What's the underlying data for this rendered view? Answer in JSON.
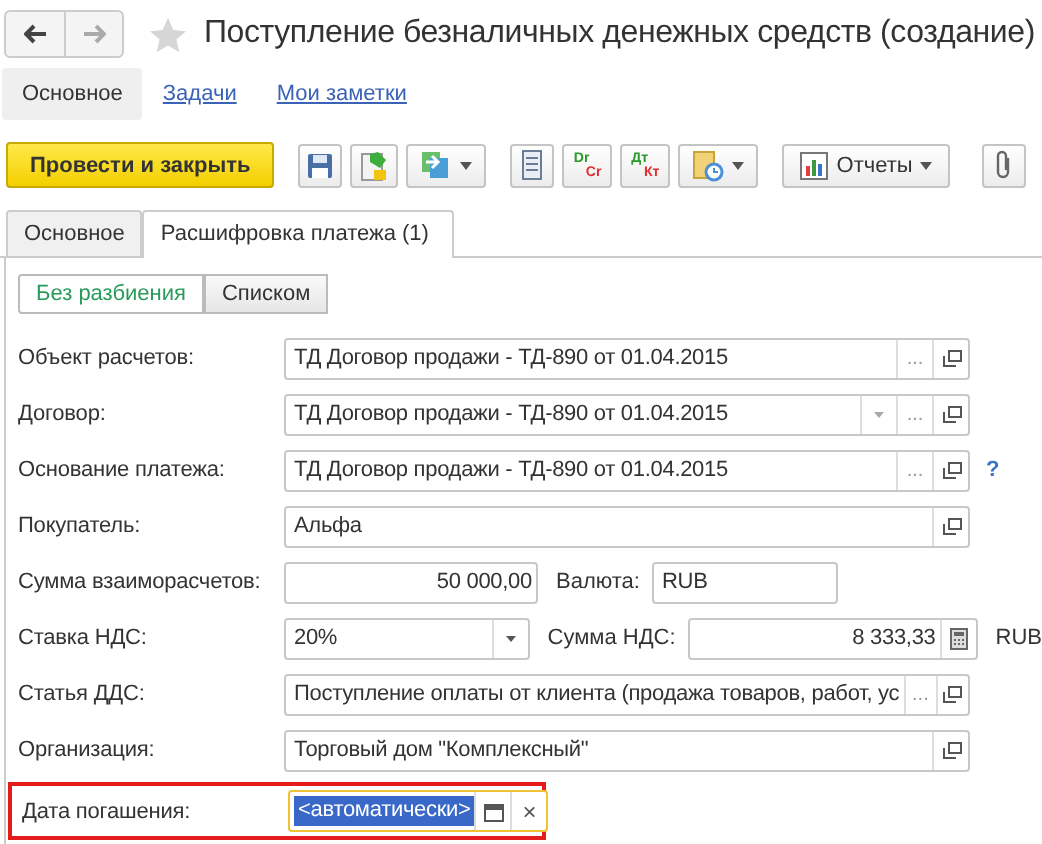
{
  "window": {
    "title": "Поступление безналичных денежных средств (создание)"
  },
  "nav": [
    {
      "label": "Основное",
      "selected": true
    },
    {
      "label": "Задачи",
      "selected": false
    },
    {
      "label": "Мои заметки",
      "selected": false
    }
  ],
  "toolbar": [
    {
      "kind": "primary",
      "label": "Провести и закрыть"
    },
    {
      "kind": "save"
    },
    {
      "kind": "post"
    },
    {
      "kind": "copy",
      "dropdown": true
    },
    {
      "kind": "list"
    },
    {
      "kind": "drcr",
      "top": "Dr",
      "bottom": "Cr"
    },
    {
      "kind": "drcr",
      "top": "Дт",
      "bottom": "Кт"
    },
    {
      "kind": "docs",
      "dropdown": true
    },
    {
      "kind": "reports",
      "label": "Отчеты",
      "dropdown": true
    },
    {
      "kind": "attach"
    }
  ],
  "tabs": [
    {
      "label": "Основное",
      "selected": false
    },
    {
      "label": "Расшифровка платежа (1)",
      "selected": true
    }
  ],
  "modes": [
    {
      "label": "Без разбиения",
      "selected": true
    },
    {
      "label": "Списком",
      "selected": false
    }
  ],
  "rows": [
    {
      "kind": "single",
      "label": "Объект расчетов:",
      "value": "ТД Договор продажи - ТД-890 от 01.04.2015",
      "buttons": [
        {
          "kind": "select",
          "text": "..."
        },
        {
          "kind": "open"
        }
      ]
    },
    {
      "kind": "single",
      "label": "Договор:",
      "value": "ТД Договор продажи - ТД-890 от 01.04.2015",
      "buttons": [
        {
          "kind": "dropdown"
        },
        {
          "kind": "select",
          "text": "..."
        },
        {
          "kind": "open"
        }
      ]
    },
    {
      "kind": "single",
      "label": "Основание платежа:",
      "value": "ТД Договор продажи - ТД-890 от 01.04.2015",
      "buttons": [
        {
          "kind": "select",
          "text": "..."
        },
        {
          "kind": "open"
        }
      ],
      "help": "?"
    },
    {
      "kind": "single",
      "label": "Покупатель:",
      "value": "Альфа",
      "buttons": [
        {
          "kind": "open"
        }
      ]
    },
    {
      "kind": "pair",
      "label": "Сумма взаиморасчетов:",
      "value": "50 000,00",
      "buttons": [],
      "label2": "Валюта:",
      "value2": "RUB",
      "buttons2": []
    },
    {
      "kind": "pair",
      "label": "Ставка НДС:",
      "value": "20%",
      "buttons": [
        {
          "kind": "dropdown"
        }
      ],
      "label2": "Сумма НДС:",
      "value2": "8 333,33",
      "buttons2": [
        {
          "kind": "calculator"
        }
      ],
      "suffix": "RUB"
    },
    {
      "kind": "single",
      "label": "Статья ДДС:",
      "value": "Поступление оплаты от клиента (продажа товаров, работ, ус",
      "buttons": [
        {
          "kind": "select",
          "text": "..."
        },
        {
          "kind": "open"
        }
      ]
    },
    {
      "kind": "single",
      "label": "Организация:",
      "value": "Торговый дом \"Комплексный\"",
      "buttons": [
        {
          "kind": "open"
        }
      ]
    },
    {
      "kind": "date",
      "label": "Дата погашения:",
      "value": "<автоматически>",
      "highlighted": true,
      "buttons": [
        {
          "kind": "calendar"
        },
        {
          "kind": "clear",
          "text": "×"
        }
      ]
    }
  ]
}
